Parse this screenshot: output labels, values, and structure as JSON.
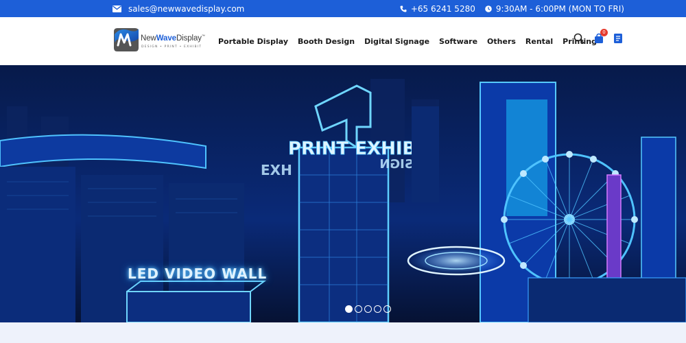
{
  "topbar": {
    "email": "sales@newwavedisplay.com",
    "phone": "+65 6241 5280",
    "hours": "9:30AM - 6:00PM (MON TO FRI)"
  },
  "logo": {
    "brand_prefix": "New",
    "brand_highlight": "Wave",
    "brand_suffix": "Display",
    "trademark": "™",
    "tagline": "DESIGN • PRINT • EXHIBIT"
  },
  "nav": {
    "items": [
      {
        "label": "Portable Display"
      },
      {
        "label": "Booth Design"
      },
      {
        "label": "Digital Signage"
      },
      {
        "label": "Software"
      },
      {
        "label": "Others"
      },
      {
        "label": "Rental"
      },
      {
        "label": "Printing"
      }
    ]
  },
  "header_icons": {
    "search_icon": "search-icon",
    "cart_icon": "cart-icon",
    "cart_count": "0",
    "catalog_icon": "book-icon"
  },
  "hero": {
    "sign_text_front": "PRINT EXHIBIT",
    "sign_text_left": "EXH",
    "sign_text_design": "DESIGN",
    "wall_text": "LED VIDEO WALL",
    "slides": 5,
    "active_slide": 1
  },
  "colors": {
    "topbar": "#1d5fd8",
    "neon": "#4fc3ff",
    "hero_bg": "#061233"
  }
}
